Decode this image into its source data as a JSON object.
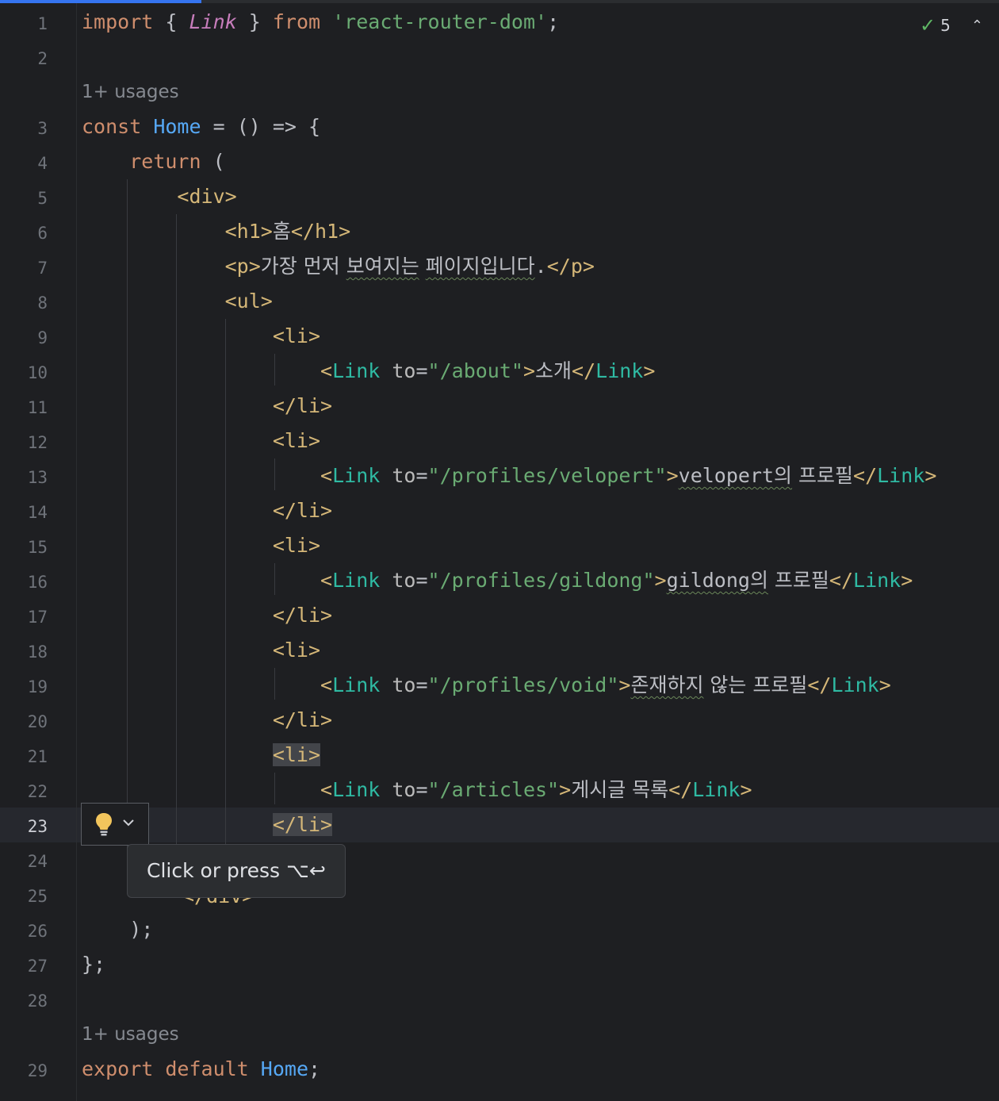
{
  "editor": {
    "inspection": {
      "check_icon": "check-icon",
      "count": "5",
      "collapse_icon": "chevron-up-icon"
    },
    "usage_hint": "1+ usages",
    "gutter_numbers": [
      "1",
      "2",
      "3",
      "4",
      "5",
      "6",
      "7",
      "8",
      "9",
      "10",
      "11",
      "12",
      "13",
      "14",
      "15",
      "16",
      "17",
      "18",
      "19",
      "20",
      "21",
      "22",
      "23",
      "24",
      "25",
      "26",
      "27",
      "28",
      "29"
    ],
    "current_line": "23",
    "code": {
      "l1": {
        "kw1": "import",
        "p1": " { ",
        "name": "Link",
        "p2": " } ",
        "kw2": "from",
        "sp": " ",
        "str": "'react-router-dom'",
        "end": ";"
      },
      "l3": {
        "kw": "const",
        "sp": " ",
        "name": "Home",
        "rest": " = () => {"
      },
      "l4": {
        "indent": "    ",
        "kw": "return",
        "rest": " ("
      },
      "l5": {
        "indent": "        ",
        "tag": "<div>"
      },
      "l6": {
        "indent": "            ",
        "open": "<h1>",
        "text": "홈",
        "close": "</h1>"
      },
      "l7": {
        "indent": "            ",
        "open": "<p>",
        "t1": "가장 먼저 ",
        "t2": "보여지는",
        "t3": " ",
        "t4": "페이지입니다",
        "t5": ".",
        "close": "</p>"
      },
      "l8": {
        "indent": "            ",
        "tag": "<ul>"
      },
      "l9": {
        "indent": "                ",
        "tag": "<li>"
      },
      "l10": {
        "indent": "                    ",
        "lt": "<",
        "comp": "Link",
        "sp": " ",
        "attr": "to",
        "eq": "=",
        "val": "\"/about\"",
        "gt": ">",
        "text": "소개",
        "clt": "</",
        "ccomp": "Link",
        "cgt": ">"
      },
      "l11": {
        "indent": "                ",
        "tag": "</li>"
      },
      "l12": {
        "indent": "                ",
        "tag": "<li>"
      },
      "l13": {
        "indent": "                    ",
        "lt": "<",
        "comp": "Link",
        "sp": " ",
        "attr": "to",
        "eq": "=",
        "val": "\"/profiles/velopert\"",
        "gt": ">",
        "text1": "velopert의",
        "text2": " 프로필",
        "clt": "</",
        "ccomp": "Link",
        "cgt": ">"
      },
      "l14": {
        "indent": "                ",
        "tag": "</li>"
      },
      "l15": {
        "indent": "                ",
        "tag": "<li>"
      },
      "l16": {
        "indent": "                    ",
        "lt": "<",
        "comp": "Link",
        "sp": " ",
        "attr": "to",
        "eq": "=",
        "val": "\"/profiles/gildong\"",
        "gt": ">",
        "text1": "gildong의",
        "text2": " 프로필",
        "clt": "</",
        "ccomp": "Link",
        "cgt": ">"
      },
      "l17": {
        "indent": "                ",
        "tag": "</li>"
      },
      "l18": {
        "indent": "                ",
        "tag": "<li>"
      },
      "l19": {
        "indent": "                    ",
        "lt": "<",
        "comp": "Link",
        "sp": " ",
        "attr": "to",
        "eq": "=",
        "val": "\"/profiles/void\"",
        "gt": ">",
        "text1": "존재하지",
        "text2": " 않는 프로필",
        "clt": "</",
        "ccomp": "Link",
        "cgt": ">"
      },
      "l20": {
        "indent": "                ",
        "tag": "</li>"
      },
      "l21": {
        "indent": "                ",
        "tag": "<li>"
      },
      "l22": {
        "indent": "                    ",
        "lt": "<",
        "comp": "Link",
        "sp": " ",
        "attr": "to",
        "eq": "=",
        "val": "\"/articles\"",
        "gt": ">",
        "text": "게시글 목록",
        "clt": "</",
        "ccomp": "Link",
        "cgt": ">"
      },
      "l23": {
        "indent": "                ",
        "tag": "</li>"
      },
      "l25": {
        "tag": "</div>"
      },
      "l26": {
        "indent": "    ",
        "rest": ");"
      },
      "l27": {
        "rest": "};"
      },
      "l29": {
        "kw1": "export",
        "sp1": " ",
        "kw2": "default",
        "sp2": " ",
        "name": "Home",
        "end": ";"
      }
    },
    "intention": {
      "bulb_icon": "lightbulb-icon",
      "chevron_icon": "chevron-down-icon"
    },
    "tooltip": {
      "text": "Click or press ⌥↩"
    }
  },
  "colors": {
    "background": "#1e1f22",
    "keyword": "#cf8e6d",
    "function": "#56a8f5",
    "import_name": "#c77dbb",
    "string": "#6aab73",
    "html_tag": "#d5b778",
    "component": "#2fbaa3",
    "accent": "#3574f0"
  }
}
